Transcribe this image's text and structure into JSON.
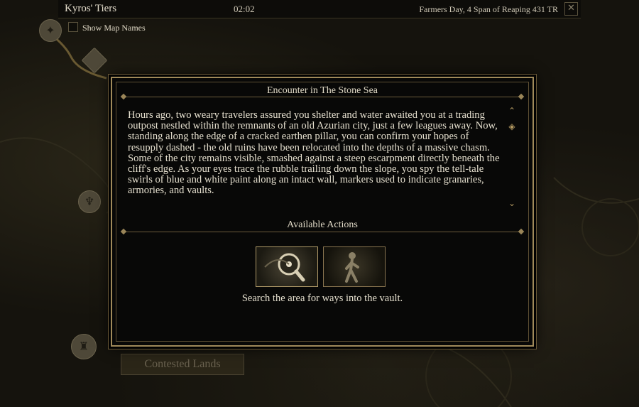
{
  "top_bar": {
    "location": "Kyros' Tiers",
    "time": "02:02",
    "date": "Farmers Day, 4 Span of Reaping 431 TR",
    "close_label": "✕"
  },
  "map": {
    "show_map_names_label": "Show Map Names",
    "region_label": "Contested Lands"
  },
  "dialog": {
    "title": "Encounter in The Stone Sea",
    "body": "Hours ago, two weary travelers assured you shelter and water awaited you at a trading outpost nestled within the remnants of an old Azurian city, just a few leagues away. Now, standing along the edge of a cracked earthen pillar, you can confirm your hopes of resupply dashed - the old ruins have been relocated into the depths of a massive chasm. Some of the city remains visible, smashed against a steep escarpment directly beneath the cliff's edge. As your eyes trace the rubble trailing down the slope, you spy the tell-tale swirls of blue and white paint along an intact wall, markers used to indicate granaries, armories, and vaults.",
    "actions_title": "Available Actions",
    "actions": [
      {
        "icon": "magnifying-glass-icon",
        "selected": true
      },
      {
        "icon": "walking-figure-icon",
        "selected": false
      }
    ],
    "selected_action_description": "Search the area for ways into the vault."
  },
  "colors": {
    "frame_gold": "#a08a5a",
    "text": "#e6e0cf",
    "background": "#080807"
  }
}
